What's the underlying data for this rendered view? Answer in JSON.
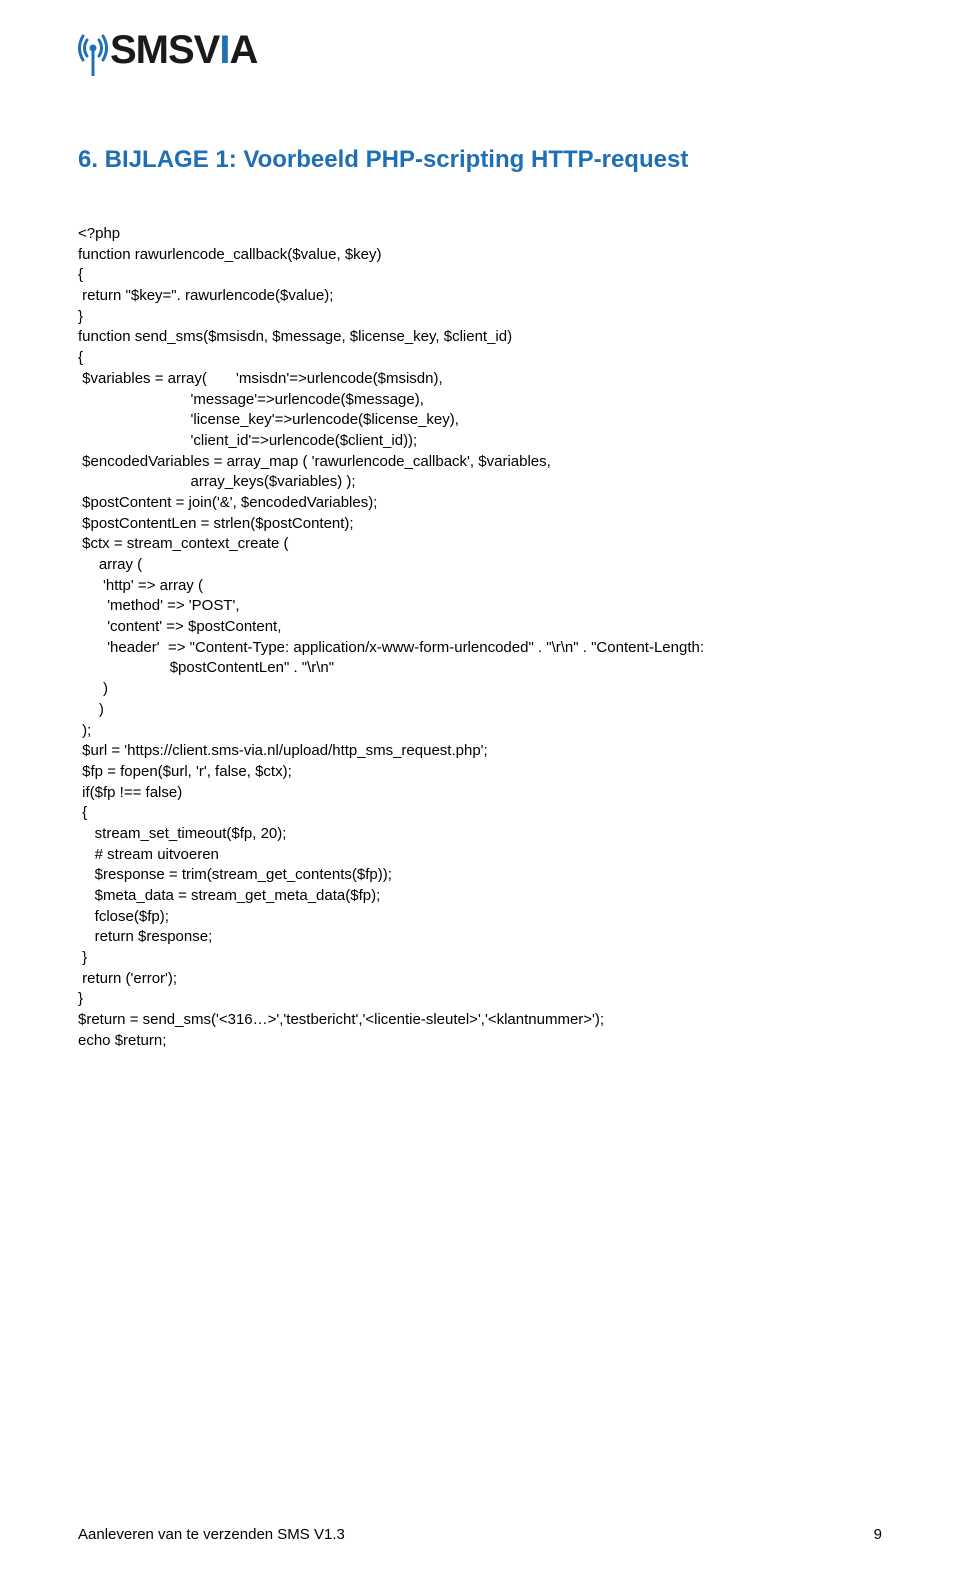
{
  "logo": {
    "text_dark": "SMSV",
    "text_accent": "I",
    "text_dark2": "A",
    "icon_name": "signal-tower-icon",
    "accent_color": "#2070b8"
  },
  "heading": "6. BIJLAGE 1: Voorbeeld PHP-scripting HTTP-request",
  "code_lines": [
    "<?php",
    "function rawurlencode_callback($value, $key)",
    "{",
    " return \"$key=\". rawurlencode($value);",
    "}",
    "function send_sms($msisdn, $message, $license_key, $client_id)",
    "{",
    " $variables = array(       'msisdn'=>urlencode($msisdn),",
    "                           'message'=>urlencode($message),",
    "                           'license_key'=>urlencode($license_key),",
    "                           'client_id'=>urlencode($client_id));",
    " $encodedVariables = array_map ( 'rawurlencode_callback', $variables,",
    "                           array_keys($variables) );",
    " $postContent = join('&', $encodedVariables);",
    " $postContentLen = strlen($postContent);",
    " $ctx = stream_context_create (",
    "     array (",
    "      'http' => array (",
    "       'method' => 'POST',",
    "       'content' => $postContent,",
    "       'header'  => \"Content-Type: application/x-www-form-urlencoded\" . \"\\r\\n\" . \"Content-Length:",
    "                      $postContentLen\" . \"\\r\\n\"",
    "      )",
    "     )",
    " );",
    " $url = 'https://client.sms-via.nl/upload/http_sms_request.php';",
    " $fp = fopen($url, 'r', false, $ctx);",
    " if($fp !== false)",
    " {",
    "    stream_set_timeout($fp, 20);",
    "    # stream uitvoeren",
    "    $response = trim(stream_get_contents($fp));",
    "    $meta_data = stream_get_meta_data($fp);",
    "    fclose($fp);",
    "    return $response;",
    " }",
    " return ('error');",
    "}",
    "$return = send_sms('<316…>','testbericht','<licentie-sleutel>','<klantnummer>');",
    "echo $return;"
  ],
  "footer": {
    "left": "Aanleveren van te verzenden SMS V1.3",
    "right": "9"
  }
}
